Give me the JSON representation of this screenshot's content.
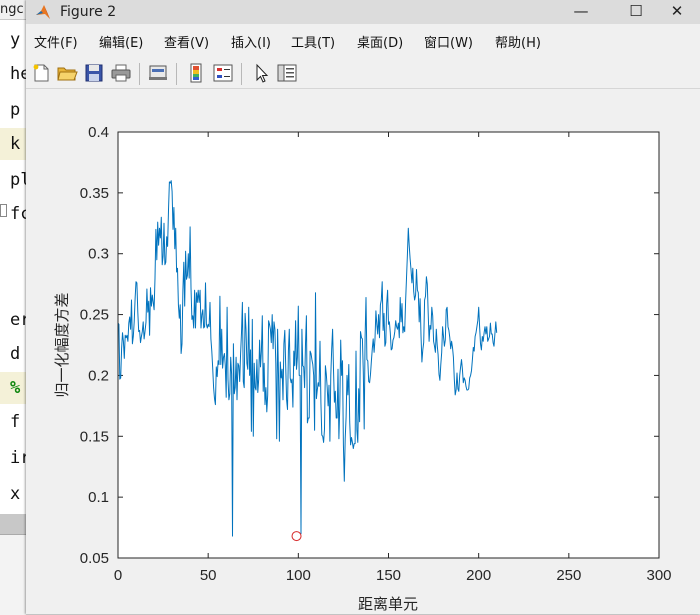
{
  "editor": {
    "tab_label": "ngc",
    "lines": [
      "y",
      "he",
      "p",
      "k",
      "pl",
      "fc",
      "",
      "",
      "er",
      "d",
      "%",
      "f",
      "ir",
      "x"
    ]
  },
  "window": {
    "title": "Figure 2",
    "controls": {
      "minimize": "—",
      "maximize": "☐",
      "close": "✕"
    }
  },
  "menu": [
    "文件(F)",
    "编辑(E)",
    "查看(V)",
    "插入(I)",
    "工具(T)",
    "桌面(D)",
    "窗口(W)",
    "帮助(H)"
  ],
  "toolbar": [
    "new-figure-icon",
    "open-file-icon",
    "save-icon",
    "print-icon",
    "link-plot-icon",
    "colorbar-icon",
    "legend-icon",
    "pointer-icon",
    "property-inspector-icon"
  ],
  "colors": {
    "line": "#0072bd",
    "marker": "#d62728",
    "title_bar": "#dcdcdc"
  },
  "chart_data": {
    "type": "line",
    "xlabel": "距离单元",
    "ylabel": "归一化幅度方差",
    "xlim": [
      0,
      300
    ],
    "ylim": [
      0.05,
      0.4
    ],
    "xticks": [
      "0",
      "50",
      "100",
      "150",
      "200",
      "250",
      "300"
    ],
    "yticks": [
      "0.05",
      "0.1",
      "0.15",
      "0.2",
      "0.25",
      "0.3",
      "0.35",
      "0.4"
    ],
    "grid": false,
    "series": [
      {
        "y": [
          0.243,
          0.242,
          0.197,
          0.198,
          0.222,
          0.235,
          0.228,
          0.214,
          0.233,
          0.231,
          0.233,
          0.228,
          0.243,
          0.248,
          0.238,
          0.262,
          0.226,
          0.232,
          0.244,
          0.263,
          0.277,
          0.276,
          0.252,
          0.236,
          0.237,
          0.227,
          0.232,
          0.236,
          0.244,
          0.23,
          0.236,
          0.244,
          0.271,
          0.252,
          0.261,
          0.233,
          0.272,
          0.257,
          0.266,
          0.26,
          0.254,
          0.28,
          0.32,
          0.295,
          0.326,
          0.307,
          0.321,
          0.313,
          0.33,
          0.291,
          0.298,
          0.325,
          0.291,
          0.293,
          0.314,
          0.306,
          0.336,
          0.359,
          0.358,
          0.36,
          0.351,
          0.32,
          0.338,
          0.304,
          0.321,
          0.285,
          0.288,
          0.258,
          0.247,
          0.258,
          0.218,
          0.226,
          0.27,
          0.293,
          0.257,
          0.302,
          0.279,
          0.282,
          0.3,
          0.28,
          0.322,
          0.272,
          0.246,
          0.249,
          0.239,
          0.27,
          0.239,
          0.268,
          0.26,
          0.27,
          0.26,
          0.27,
          0.239,
          0.25,
          0.254,
          0.239,
          0.24,
          0.276,
          0.242,
          0.239,
          0.242,
          0.24,
          0.26,
          0.23,
          0.22,
          0.206,
          0.19,
          0.181,
          0.176,
          0.207,
          0.199,
          0.212,
          0.209,
          0.265,
          0.209,
          0.238,
          0.206,
          0.215,
          0.218,
          0.208,
          0.182,
          0.256,
          0.197,
          0.18,
          0.185,
          0.215,
          0.201,
          0.068,
          0.226,
          0.185,
          0.19,
          0.215,
          0.18,
          0.21,
          0.208,
          0.195,
          0.218,
          0.235,
          0.26,
          0.195,
          0.19,
          0.251,
          0.238,
          0.21,
          0.205,
          0.256,
          0.2,
          0.221,
          0.154,
          0.246,
          0.15,
          0.21,
          0.19,
          0.188,
          0.213,
          0.186,
          0.197,
          0.229,
          0.207,
          0.22,
          0.249,
          0.187,
          0.21,
          0.176,
          0.19,
          0.17,
          0.184,
          0.245,
          0.242,
          0.238,
          0.227,
          0.25,
          0.222,
          0.244,
          0.238,
          0.21,
          0.148,
          0.238,
          0.2,
          0.146,
          0.211,
          0.198,
          0.205,
          0.18,
          0.226,
          0.237,
          0.208,
          0.18,
          0.172,
          0.22,
          0.238,
          0.198,
          0.194,
          0.197,
          0.174,
          0.22,
          0.208,
          0.245,
          0.205,
          0.215,
          0.257,
          0.2,
          0.2,
          0.07,
          0.238,
          0.208,
          0.207,
          0.19,
          0.226,
          0.249,
          0.161,
          0.165,
          0.165,
          0.22,
          0.218,
          0.213,
          0.209,
          0.2,
          0.155,
          0.268,
          0.181,
          0.188,
          0.194,
          0.191,
          0.228,
          0.178,
          0.151,
          0.15,
          0.145,
          0.156,
          0.208,
          0.201,
          0.19,
          0.175,
          0.192,
          0.146,
          0.2,
          0.222,
          0.238,
          0.205,
          0.178,
          0.187,
          0.165,
          0.165,
          0.205,
          0.148,
          0.175,
          0.229,
          0.2,
          0.212,
          0.143,
          0.113,
          0.148,
          0.166,
          0.2,
          0.184,
          0.209,
          0.162,
          0.143,
          0.149,
          0.145,
          0.14,
          0.144,
          0.144,
          0.22,
          0.155,
          0.145,
          0.189,
          0.162,
          0.236,
          0.231,
          0.23,
          0.203,
          0.156,
          0.232,
          0.264,
          0.213,
          0.212,
          0.195,
          0.194,
          0.201,
          0.212,
          0.222,
          0.23,
          0.219,
          0.23,
          0.253,
          0.242,
          0.234,
          0.25,
          0.231,
          0.258,
          0.262,
          0.277,
          0.237,
          0.251,
          0.224,
          0.227,
          0.259,
          0.27,
          0.242,
          0.244,
          0.235,
          0.221,
          0.222,
          0.229,
          0.231,
          0.236,
          0.245,
          0.24,
          0.238,
          0.243,
          0.231,
          0.264,
          0.244,
          0.259,
          0.235,
          0.24,
          0.236,
          0.261,
          0.28,
          0.299,
          0.321,
          0.307,
          0.296,
          0.287,
          0.276,
          0.288,
          0.269,
          0.262,
          0.266,
          0.287,
          0.27,
          0.268,
          0.244,
          0.263,
          0.233,
          0.211,
          0.221,
          0.227,
          0.262,
          0.265,
          0.281,
          0.275,
          0.251,
          0.228,
          0.241,
          0.238,
          0.256,
          0.249,
          0.228,
          0.224,
          0.219,
          0.238,
          0.225,
          0.217,
          0.201,
          0.196,
          0.209,
          0.219,
          0.24,
          0.232,
          0.224,
          0.229,
          0.254,
          0.256,
          0.24,
          0.237,
          0.231,
          0.222,
          0.228,
          0.223,
          0.215,
          0.197,
          0.184,
          0.188,
          0.202,
          0.189,
          0.187,
          0.2,
          0.207,
          0.213,
          0.205,
          0.194,
          0.198,
          0.196,
          0.191,
          0.188,
          0.188,
          0.189,
          0.198,
          0.2,
          0.204,
          0.213,
          0.223,
          0.22,
          0.232,
          0.235,
          0.24,
          0.245,
          0.256,
          0.24,
          0.226,
          0.221,
          0.232,
          0.228,
          0.235,
          0.24,
          0.234,
          0.24,
          0.228,
          0.23,
          0.232,
          0.243,
          0.234,
          0.234,
          0.227,
          0.224,
          0.234,
          0.244,
          0.235
        ],
        "x_step": 0.5,
        "x_start": 0
      }
    ],
    "marker": {
      "x": 99,
      "y": 0.068,
      "style": "circle"
    }
  }
}
